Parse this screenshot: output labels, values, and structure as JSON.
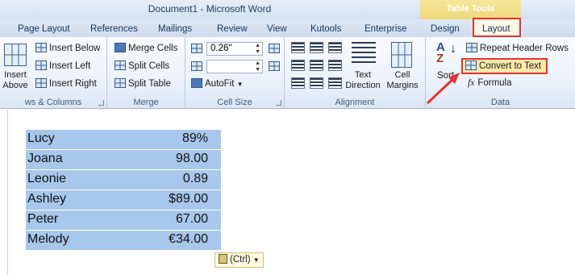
{
  "window": {
    "title": "Document1  -  Microsoft Word"
  },
  "contextual": {
    "label": "Table Tools",
    "color": "#e6c959"
  },
  "tabs": [
    "Page Layout",
    "References",
    "Mailings",
    "Review",
    "View",
    "Kutools",
    "Enterprise",
    "Design",
    "Layout"
  ],
  "groups": {
    "rows_columns": {
      "label": "ws & Columns",
      "insert_above": "Insert Above",
      "insert_below": "Insert Below",
      "insert_left": "Insert Left",
      "insert_right": "Insert Right"
    },
    "merge": {
      "label": "Merge",
      "merge_cells": "Merge Cells",
      "split_cells": "Split Cells",
      "split_table": "Split Table"
    },
    "cell_size": {
      "label": "Cell Size",
      "height_value": "0.26\"",
      "autofit": "AutoFit"
    },
    "alignment": {
      "label": "Alignment",
      "text_direction": "Text Direction",
      "cell_margins": "Cell Margins"
    },
    "data": {
      "label": "Data",
      "sort": "Sort",
      "repeat_header": "Repeat Header Rows",
      "convert_to_text": "Convert to Text",
      "formula": "Formula"
    }
  },
  "table": {
    "rows": [
      {
        "name": "Lucy",
        "value": "89%"
      },
      {
        "name": "Joana",
        "value": "98.00"
      },
      {
        "name": "Leonie",
        "value": "0.89"
      },
      {
        "name": "Ashley",
        "value": "$89.00"
      },
      {
        "name": "Peter",
        "value": "67.00"
      },
      {
        "name": "Melody",
        "value": "€34.00"
      }
    ]
  },
  "paste_options": {
    "label": "(Ctrl)"
  },
  "colors": {
    "highlight": "#e53333",
    "selection": "#a8c7ec",
    "arrow": "#e53333"
  }
}
